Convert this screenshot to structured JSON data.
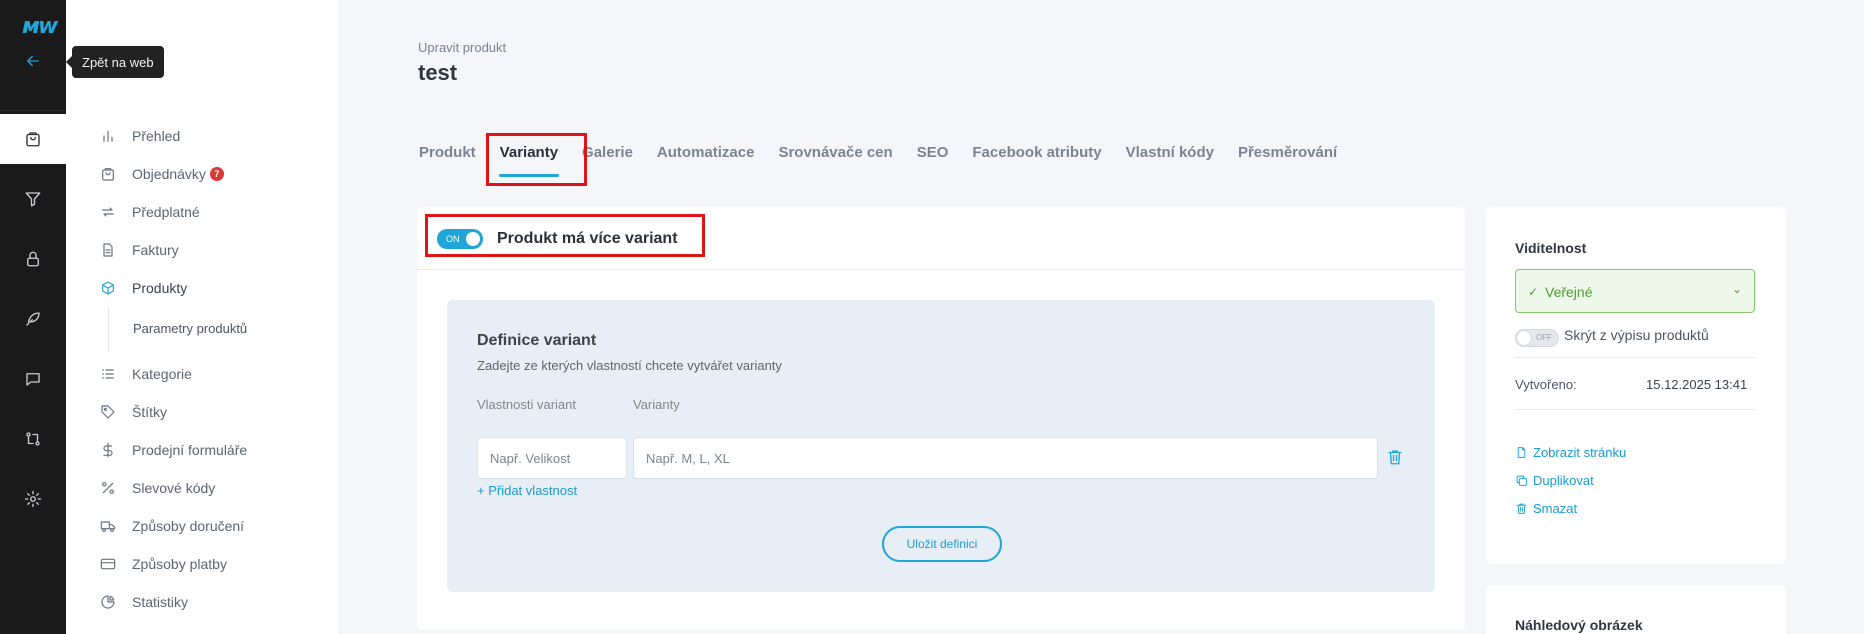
{
  "rail": {
    "logo": "ᴍᴡ",
    "tooltip": "Zpět na web"
  },
  "sidebar": {
    "items": [
      {
        "label": "Přehled"
      },
      {
        "label": "Objednávky",
        "badge": "7"
      },
      {
        "label": "Předplatné"
      },
      {
        "label": "Faktury"
      },
      {
        "label": "Produkty"
      },
      {
        "label": "Kategorie"
      },
      {
        "label": "Štítky"
      },
      {
        "label": "Prodejní formuláře"
      },
      {
        "label": "Slevové kódy"
      },
      {
        "label": "Způsoby doručení"
      },
      {
        "label": "Způsoby platby"
      },
      {
        "label": "Statistiky"
      }
    ],
    "sub_item": "Parametry produktů"
  },
  "header": {
    "breadcrumb": "Upravit produkt",
    "title": "test"
  },
  "tabs": [
    "Produkt",
    "Varianty",
    "Galerie",
    "Automatizace",
    "Srovnávače cen",
    "SEO",
    "Facebook atributy",
    "Vlastní kódy",
    "Přesměrování"
  ],
  "variants": {
    "toggle_label": "ON",
    "title": "Produkt má více variant",
    "definition": {
      "title": "Definice variant",
      "subtitle": "Zadejte ze kterých vlastností chcete vytvářet varianty",
      "property_label": "Vlastnosti variant",
      "variants_label": "Varianty",
      "property_placeholder": "Např. Velikost",
      "variants_placeholder": "Např. M, L, XL",
      "add_property": "+ Přidat vlastnost",
      "save_button": "Uložit definici"
    }
  },
  "right_panel": {
    "visibility_title": "Viditelnost",
    "visibility_value": "Veřejné",
    "hide_toggle_label": "OFF",
    "hide_label": "Skrýt z výpisu produktů",
    "created_label": "Vytvořeno:",
    "created_value": "15.12.2025 13:41",
    "actions": [
      "Zobrazit stránku",
      "Duplikovat",
      "Smazat"
    ],
    "preview_title": "Náhledový obrázek"
  },
  "colors": {
    "accent": "#1fa5d6",
    "highlight": "#e01418",
    "rail_bg": "#1a1a1a",
    "success": "#4e9b34"
  }
}
